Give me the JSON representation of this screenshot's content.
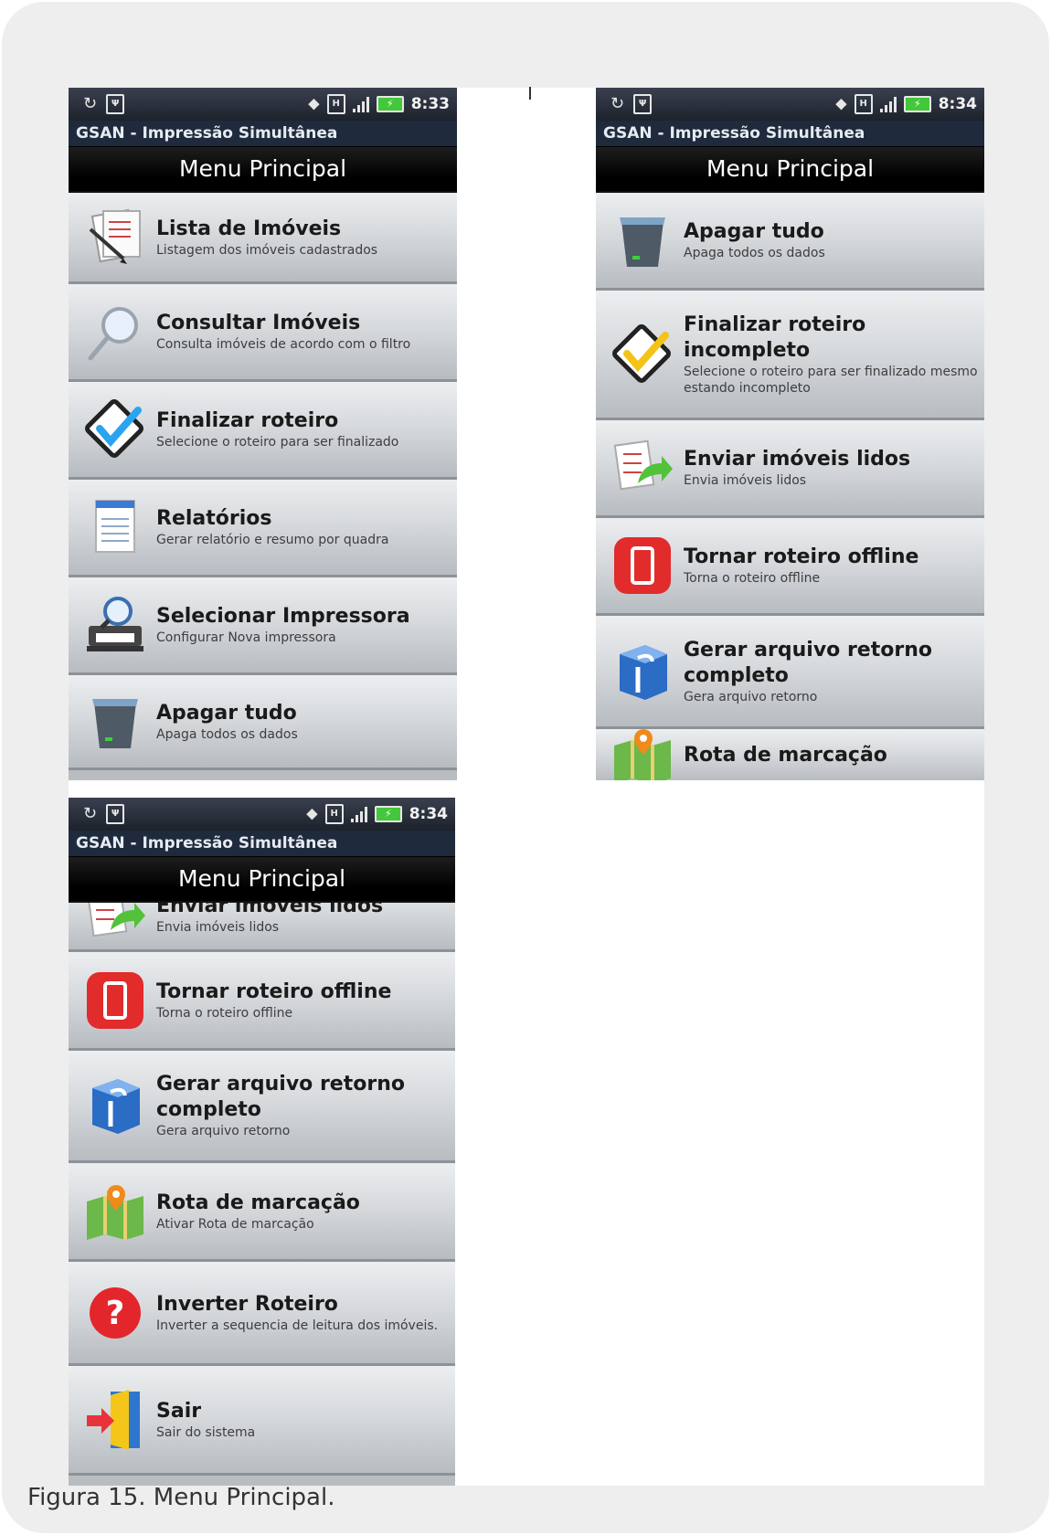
{
  "caption": "Figura 15. Menu Principal.",
  "app_title": "GSAN - Impressão Simultânea",
  "menu_header": "Menu Principal",
  "screens": [
    {
      "clock": "8:33",
      "items": [
        {
          "title": "Lista de Imóveis",
          "subtitle": "Listagem dos imóveis cadastrados",
          "icon": "document-list-icon"
        },
        {
          "title": "Consultar Imóveis",
          "subtitle": "Consulta imóveis de acordo com o filtro",
          "icon": "magnifier-icon"
        },
        {
          "title": "Finalizar roteiro",
          "subtitle": "Selecione o roteiro para ser finalizado",
          "icon": "checkmark-icon"
        },
        {
          "title": "Relatórios",
          "subtitle": "Gerar relatório e resumo por quadra",
          "icon": "report-icon"
        },
        {
          "title": "Selecionar Impressora",
          "subtitle": "Configurar Nova impressora",
          "icon": "printer-search-icon"
        },
        {
          "title": "Apagar tudo",
          "subtitle": "Apaga todos os dados",
          "icon": "trash-bin-icon"
        }
      ]
    },
    {
      "clock": "8:34",
      "items": [
        {
          "title": "Apagar tudo",
          "subtitle": "Apaga todos os dados",
          "icon": "trash-bin-icon"
        },
        {
          "title": "Finalizar roteiro incompleto",
          "subtitle": "Selecione o roteiro para ser finalizado mesmo estando incompleto",
          "icon": "checkmark-yellow-icon"
        },
        {
          "title": "Enviar imóveis lidos",
          "subtitle": "Envia imóveis lidos",
          "icon": "send-documents-icon"
        },
        {
          "title": "Tornar roteiro offline",
          "subtitle": "Torna o roteiro offline",
          "icon": "offline-phone-icon"
        },
        {
          "title": "Gerar arquivo retorno completo",
          "subtitle": "Gera arquivo retorno",
          "icon": "box-arrow-icon"
        },
        {
          "title": "Rota de marcação",
          "subtitle": "",
          "icon": "map-pin-icon"
        }
      ]
    },
    {
      "clock": "8:34",
      "items": [
        {
          "title": "Enviar imóveis lidos",
          "subtitle": "Envia imóveis lidos",
          "icon": "send-documents-icon"
        },
        {
          "title": "Tornar roteiro offline",
          "subtitle": "Torna o roteiro offline",
          "icon": "offline-phone-icon"
        },
        {
          "title": "Gerar arquivo retorno completo",
          "subtitle": "Gera arquivo retorno",
          "icon": "box-arrow-icon"
        },
        {
          "title": "Rota de marcação",
          "subtitle": "Ativar Rota de marcação",
          "icon": "map-pin-icon"
        },
        {
          "title": "Inverter Roteiro",
          "subtitle": "Inverter a sequencia de leitura dos imóveis.",
          "icon": "question-icon"
        },
        {
          "title": "Sair",
          "subtitle": "Sair do sistema",
          "icon": "exit-door-icon"
        }
      ]
    }
  ]
}
